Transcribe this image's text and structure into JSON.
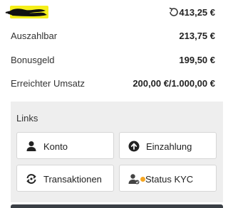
{
  "header": {
    "balance_total": "413,25 €"
  },
  "rows": [
    {
      "label": "Auszahlbar",
      "value": "213,75 €"
    },
    {
      "label": "Bonusgeld",
      "value": "199,50 €"
    },
    {
      "label": "Erreichter Umsatz",
      "value": "200,00 €/1.000,00 €"
    }
  ],
  "links": {
    "title": "Links",
    "buttons": [
      {
        "label": "Konto",
        "icon": "user-icon"
      },
      {
        "label": "Einzahlung",
        "icon": "arrow-up-circle-icon"
      },
      {
        "label": "Transaktionen",
        "icon": "transactions-cycle-icon"
      },
      {
        "label": "Status KYC",
        "icon": "user-check-icon"
      }
    ]
  },
  "colors": {
    "highlight": "#f5ef1a",
    "redaction": "#111111",
    "kyc_status_dot": "#f5a623",
    "panel_background": "#eeeeee",
    "bottom_bar": "#3a3f45"
  }
}
